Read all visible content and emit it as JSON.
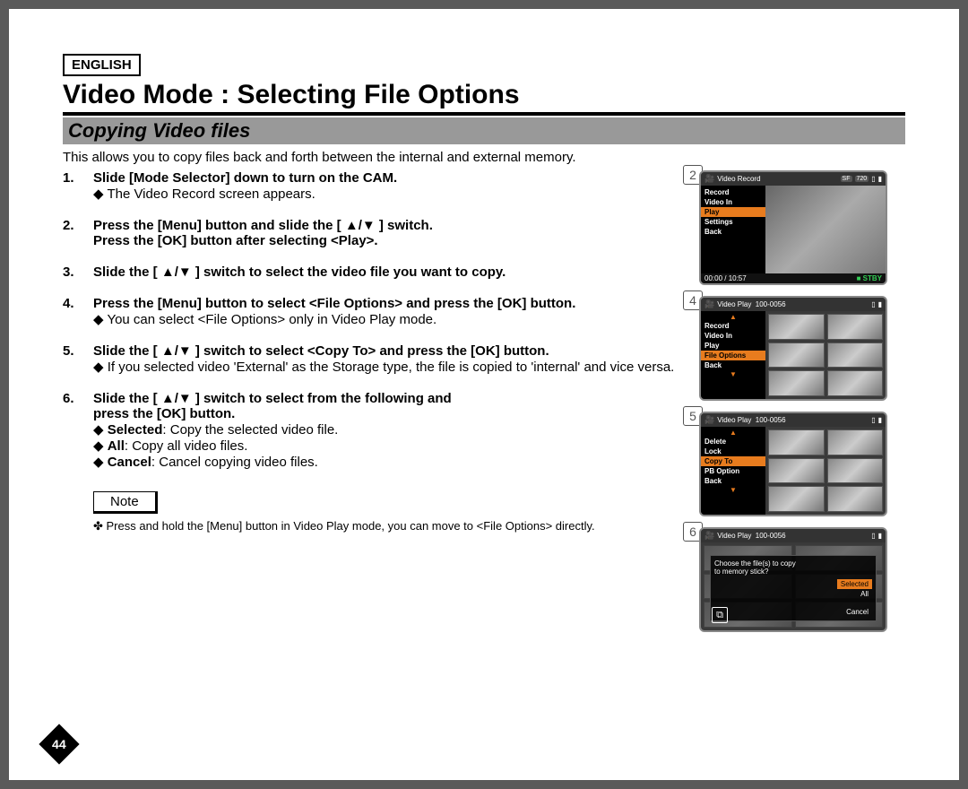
{
  "language": "ENGLISH",
  "title": "Video Mode : Selecting File Options",
  "subtitle": "Copying Video files",
  "intro": "This allows you to copy files back and forth between the internal and external memory.",
  "steps": {
    "s1": {
      "num": "1.",
      "head": "Slide [Mode Selector] down to turn on the CAM.",
      "sub1": "The Video Record screen appears."
    },
    "s2": {
      "num": "2.",
      "head_a": "Press the [Menu] button and slide the [ ▲/▼ ] switch.",
      "head_b": "Press the [OK] button after selecting <Play>."
    },
    "s3": {
      "num": "3.",
      "head": "Slide the [ ▲/▼ ] switch to select the video file you want to copy."
    },
    "s4": {
      "num": "4.",
      "head": "Press the [Menu] button to select <File Options> and press the [OK] button.",
      "sub1": "You can select <File Options> only in Video Play mode."
    },
    "s5": {
      "num": "5.",
      "head": "Slide the [ ▲/▼ ] switch to select <Copy To> and press the [OK] button.",
      "sub1": "If you selected video 'External' as the Storage type, the file is copied to 'internal' and vice versa."
    },
    "s6": {
      "num": "6.",
      "head_a": "Slide the [ ▲/▼ ] switch to select from the following and",
      "head_b": "press the [OK] button.",
      "opt1_label": "Selected",
      "opt1_text": ": Copy the selected video file.",
      "opt2_label": "All",
      "opt2_text": ": Copy all video files.",
      "opt3_label": "Cancel",
      "opt3_text": ": Cancel copying video files."
    }
  },
  "note_label": "Note",
  "note_text": "Press and hold the [Menu] button in Video Play mode, you can move to <File Options> directly.",
  "page_number": "44",
  "screens": {
    "s2": {
      "circle": "2",
      "header_title": "Video Record",
      "badge1": "SF",
      "badge2": "720",
      "menu": [
        "Record",
        "Video In",
        "Play",
        "Settings",
        "Back"
      ],
      "highlight": "Play",
      "footer_time": "00:00 / 10:57",
      "footer_status": "STBY"
    },
    "s4": {
      "circle": "4",
      "header_title": "Video Play",
      "header_code": "100-0056",
      "menu": [
        "Record",
        "Video In",
        "Play",
        "File Options",
        "Back"
      ],
      "highlight": "File Options"
    },
    "s5": {
      "circle": "5",
      "header_title": "Video Play",
      "header_code": "100-0056",
      "menu": [
        "Delete",
        "Lock",
        "Copy To",
        "PB Option",
        "Back"
      ],
      "highlight": "Copy To"
    },
    "s6": {
      "circle": "6",
      "header_title": "Video Play",
      "header_code": "100-0056",
      "dialog_text1": "Choose the file(s) to copy",
      "dialog_text2": "to memory stick?",
      "dialog_opts": [
        "Selected",
        "All",
        "Cancel"
      ],
      "dialog_hl": "Selected"
    }
  }
}
